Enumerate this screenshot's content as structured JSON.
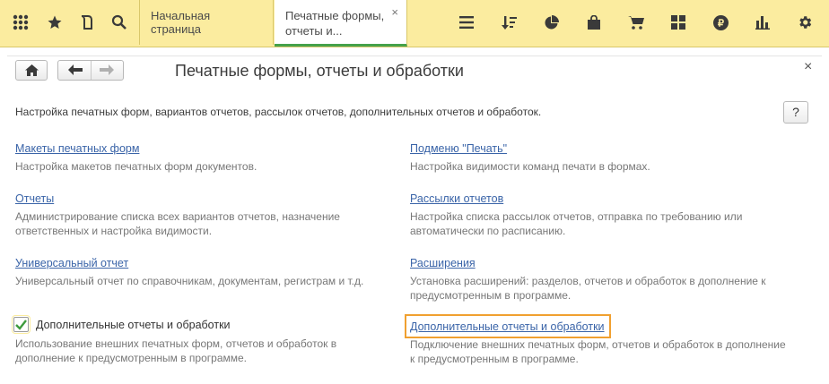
{
  "toolbar": {
    "icons": [
      "apps-grid-icon",
      "star-icon",
      "history-icon",
      "search-icon"
    ]
  },
  "tabs": [
    {
      "label": "Начальная страница"
    },
    {
      "label": "Печатные формы, отчеты и...",
      "close": "×"
    }
  ],
  "right_icons": [
    "menu-icon",
    "sort-icon",
    "pie-chart-icon",
    "bag-icon",
    "cart-icon",
    "warehouse-icon",
    "ruble-icon",
    "bar-chart-icon",
    "settings-icon"
  ],
  "page": {
    "title": "Печатные формы, отчеты и обработки",
    "close": "×",
    "description": "Настройка печатных форм, вариантов отчетов, рассылок отчетов, дополнительных отчетов и обработок.",
    "help": "?"
  },
  "left_items": [
    {
      "link": "Макеты печатных форм",
      "desc": "Настройка макетов печатных форм документов."
    },
    {
      "link": "Отчеты",
      "desc": "Администрирование списка всех вариантов отчетов, назначение ответственных и настройка видимости."
    },
    {
      "link": "Универсальный отчет",
      "desc": "Универсальный отчет по справочникам, документам, регистрам и т.д."
    }
  ],
  "right_items": [
    {
      "link": "Подменю \"Печать\"",
      "desc": "Настройка видимости команд печати в формах."
    },
    {
      "link": "Рассылки отчетов",
      "desc": "Настройка списка рассылок отчетов, отправка по требованию или автоматически по расписанию."
    },
    {
      "link": "Расширения",
      "desc": "Установка расширений: разделов, отчетов и обработок в дополнение к предусмотренным в программе."
    },
    {
      "link": "Дополнительные отчеты и обработки",
      "desc": "Подключение внешних печатных форм, отчетов и обработок в дополнение к предусмотренным в программе."
    }
  ],
  "checkbox": {
    "label": "Дополнительные отчеты и обработки",
    "checked": true,
    "desc": "Использование внешних печатных форм, отчетов и обработок в дополнение к предусмотренным в программе."
  },
  "colors": {
    "toolbar": "#fbec9f",
    "link": "#3a64a8",
    "highlight": "#f0a030",
    "check": "#3d9b3d"
  }
}
